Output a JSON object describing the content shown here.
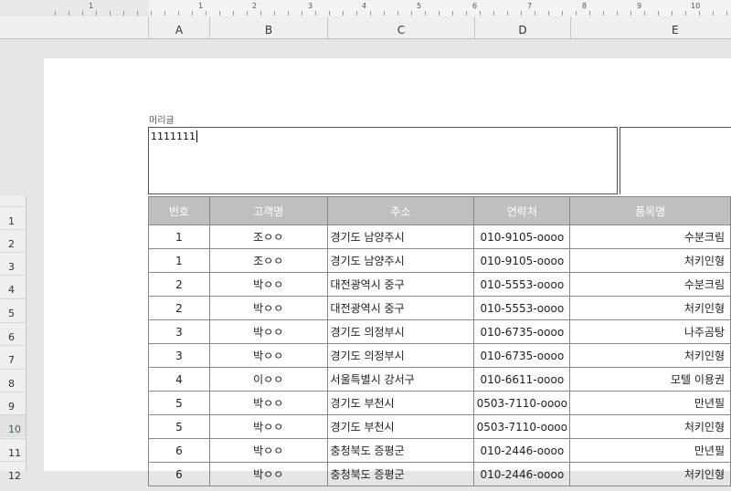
{
  "ruler": {
    "numbers": [
      "1",
      "1",
      "2",
      "3",
      "4",
      "5",
      "6",
      "7",
      "8",
      "9",
      "10"
    ]
  },
  "columns": [
    "A",
    "B",
    "C",
    "D",
    "E"
  ],
  "rows": [
    "1",
    "2",
    "3",
    "4",
    "5",
    "6",
    "7",
    "8",
    "9",
    "10",
    "11",
    "12"
  ],
  "selected_row": "10",
  "page_header": {
    "label": "머리글",
    "value": "1111111"
  },
  "table": {
    "headers": [
      "번호",
      "고객명",
      "주소",
      "연락처",
      "품목명"
    ],
    "rows": [
      [
        "1",
        "조ㅇㅇ",
        "경기도 남양주시",
        "010-9105-oooo",
        "수분크림"
      ],
      [
        "1",
        "조ㅇㅇ",
        "경기도 남양주시",
        "010-9105-oooo",
        "처키인형"
      ],
      [
        "2",
        "박ㅇㅇ",
        "대전광역시 중구",
        "010-5553-oooo",
        "수분크림"
      ],
      [
        "2",
        "박ㅇㅇ",
        "대전광역시 중구",
        "010-5553-oooo",
        "처키인형"
      ],
      [
        "3",
        "박ㅇㅇ",
        "경기도 의정부시",
        "010-6735-oooo",
        "나주곰탕"
      ],
      [
        "3",
        "박ㅇㅇ",
        "경기도 의정부시",
        "010-6735-oooo",
        "처키인형"
      ],
      [
        "4",
        "이ㅇㅇ",
        "서울특별시 강서구",
        "010-6611-oooo",
        "모텔 이용권"
      ],
      [
        "5",
        "박ㅇㅇ",
        "경기도 부천시",
        "0503-7110-oooo",
        "만년필"
      ],
      [
        "5",
        "박ㅇㅇ",
        "경기도 부천시",
        "0503-7110-oooo",
        "처키인형"
      ],
      [
        "6",
        "박ㅇㅇ",
        "충청북도 증평군",
        "010-2446-oooo",
        "만년필"
      ],
      [
        "6",
        "박ㅇㅇ",
        "충청북도 증평군",
        "010-2446-oooo",
        "처키인형"
      ]
    ]
  }
}
